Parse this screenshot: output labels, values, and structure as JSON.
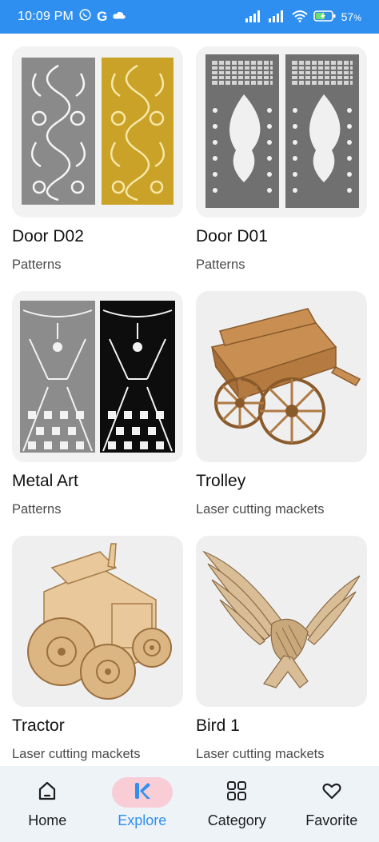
{
  "status_bar": {
    "time": "10:09 PM",
    "g_label": "G",
    "battery_percent": "57",
    "percent_sign": "%"
  },
  "items": [
    {
      "title": "Door D02",
      "subtitle": "Patterns",
      "image_icon": "door-d02-thumbnail"
    },
    {
      "title": "Door D01",
      "subtitle": "Patterns",
      "image_icon": "door-d01-thumbnail"
    },
    {
      "title": "Metal Art",
      "subtitle": "Patterns",
      "image_icon": "metal-art-thumbnail"
    },
    {
      "title": "Trolley",
      "subtitle": "Laser cutting mackets",
      "image_icon": "trolley-thumbnail"
    },
    {
      "title": "Tractor",
      "subtitle": "Laser cutting mackets",
      "image_icon": "tractor-thumbnail"
    },
    {
      "title": "Bird 1",
      "subtitle": "Laser cutting mackets",
      "image_icon": "bird-thumbnail"
    }
  ],
  "bottom_nav": {
    "active": "explore",
    "items": [
      {
        "label": "Home",
        "icon": "home-icon"
      },
      {
        "label": "Explore",
        "icon": "explore-k-icon"
      },
      {
        "label": "Category",
        "icon": "grid-icon"
      },
      {
        "label": "Favorite",
        "icon": "heart-icon"
      }
    ]
  },
  "colors": {
    "status_bar": "#2f8ff0",
    "accent": "#2f8ff0",
    "active_pill": "#f8cdd6",
    "nav_background": "#eef3f8",
    "thumb_background": "#f2f2f2"
  }
}
